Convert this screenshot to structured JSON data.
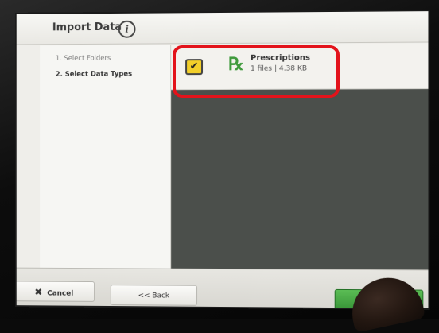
{
  "window": {
    "title": "Import Data"
  },
  "steps": [
    {
      "label": "1. Select Folders",
      "active": false
    },
    {
      "label": "2. Select Data Types",
      "active": true
    }
  ],
  "items": [
    {
      "name": "Prescriptions",
      "details": "1 files  |  4.38 KB",
      "checked": true,
      "icon": "rx-icon"
    }
  ],
  "footer": {
    "cancel_label": "Cancel",
    "back_label": "<< Back",
    "confirm_icon": "checkmark-icon"
  },
  "colors": {
    "highlight": "#e3131b",
    "checkbox": "#f2cf2a",
    "confirm": "#3f9a3c",
    "content_bg": "#4b4f4b"
  }
}
